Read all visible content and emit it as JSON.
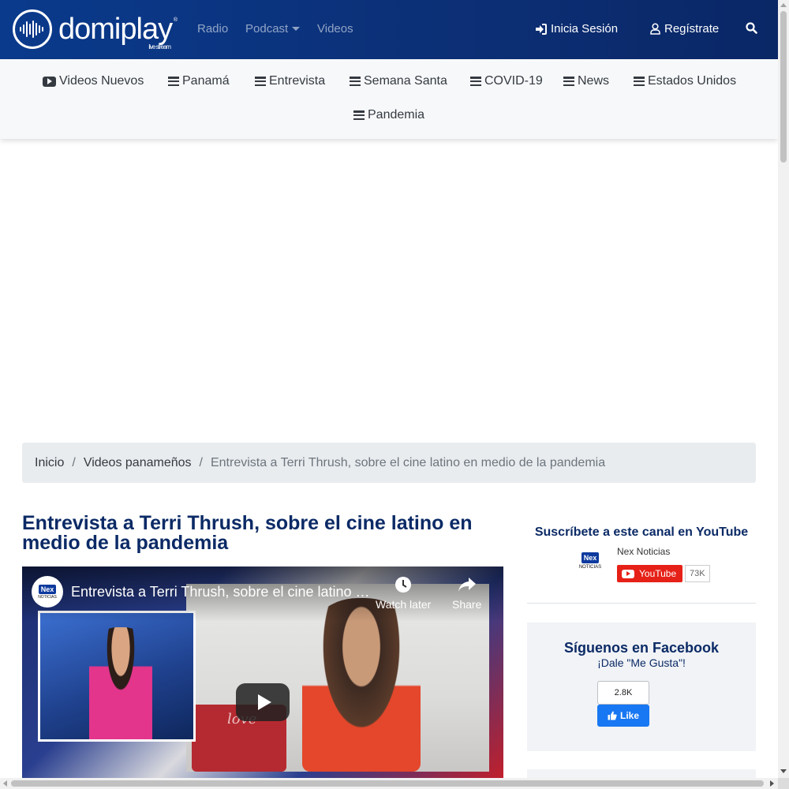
{
  "brand": {
    "name": "domiplay",
    "trademark": "®",
    "tagline": "live stream"
  },
  "nav": {
    "radio": "Radio",
    "podcast": "Podcast",
    "videos": "Videos",
    "login": "Inicia Sesión",
    "register": "Regístrate"
  },
  "categories": [
    {
      "label": "Videos Nuevos",
      "icon": "youtube-icon"
    },
    {
      "label": "Panamá",
      "icon": "bars-icon"
    },
    {
      "label": "Entrevista",
      "icon": "bars-icon"
    },
    {
      "label": "Semana Santa",
      "icon": "bars-icon"
    },
    {
      "label": "COVID-19",
      "icon": "bars-icon"
    },
    {
      "label": "News",
      "icon": "bars-icon"
    },
    {
      "label": "Estados Unidos",
      "icon": "bars-icon"
    },
    {
      "label": "Pandemia",
      "icon": "bars-icon"
    }
  ],
  "breadcrumb": {
    "home": "Inicio",
    "section": "Videos panameños",
    "current": "Entrevista a Terri Thrush, sobre el cine latino en medio de la pandemia",
    "separator": "/"
  },
  "article": {
    "title": "Entrevista a Terri Thrush, sobre el cine latino en medio de la pandemia"
  },
  "video": {
    "title": "Entrevista a Terri Thrush, sobre el cine latino e...",
    "watch_later": "Watch later",
    "share": "Share",
    "channel_logo_text": "Nex",
    "channel_logo_sub": "NOTICIAS",
    "overlay_text": "love"
  },
  "youtube_widget": {
    "heading": "Suscríbete a este canal en YouTube",
    "channel": "Nex Noticias",
    "button": "YouTube",
    "subscribers": "73K",
    "logo_text": "Nex",
    "logo_sub": "NOTICIAS"
  },
  "facebook_widget": {
    "heading": "Síguenos en Facebook",
    "subheading": "¡Dale \"Me Gusta\"!",
    "count": "2.8K",
    "like": "Like"
  },
  "colors": {
    "navbar": "#0c2f75",
    "heading": "#0b2a66",
    "youtube_red": "#e62117",
    "facebook_blue": "#1877f2"
  }
}
